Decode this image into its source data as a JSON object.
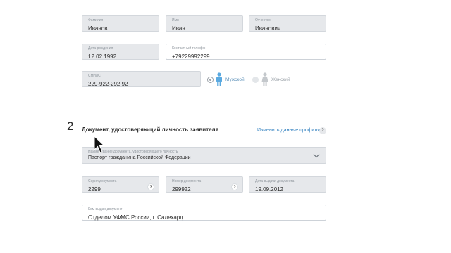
{
  "personal": {
    "last_name": {
      "label": "Фамилия",
      "value": "Иванов"
    },
    "first_name": {
      "label": "Имя",
      "value": "Иван"
    },
    "middle_name": {
      "label": "Отчество",
      "value": "Иванович"
    },
    "birth_date": {
      "label": "Дата рождения",
      "value": "12.02.1992"
    },
    "phone": {
      "label": "Контактный телефон",
      "value": "+79229992299"
    },
    "snils": {
      "label": "СНИЛС",
      "value": "229-922-292 92"
    },
    "gender": {
      "male_label": "Мужской",
      "female_label": "Женский",
      "selected": "male",
      "active_color": "#5aa9e0",
      "inactive_color": "#c4c8cc"
    }
  },
  "document_section": {
    "step_number": "2",
    "title": "Документ, удостоверяющий личность заявителя",
    "edit_profile_link": "Изменить данные профиля",
    "help_icon_text": "?",
    "doc_type": {
      "label": "Наименование документа, удостоверяющего личность",
      "value": "Паспорт гражданина Российской Федерации"
    },
    "series": {
      "label": "Серия документа",
      "value": "2299"
    },
    "number": {
      "label": "Номер документа",
      "value": "299922"
    },
    "issue_date": {
      "label": "Дата выдачи документа",
      "value": "19.09.2012"
    },
    "issued_by": {
      "label": "Кем выдан документ",
      "value": "Отделом УФМС России, г. Салехард"
    }
  },
  "icons": {
    "help": "question-mark-icon",
    "chevron": "chevron-down-icon",
    "male": "male-person-icon",
    "female": "female-person-icon",
    "cursor": "mouse-pointer-icon"
  },
  "colors": {
    "link": "#2f7fbf",
    "field_filled_bg": "#e6e8eb"
  }
}
